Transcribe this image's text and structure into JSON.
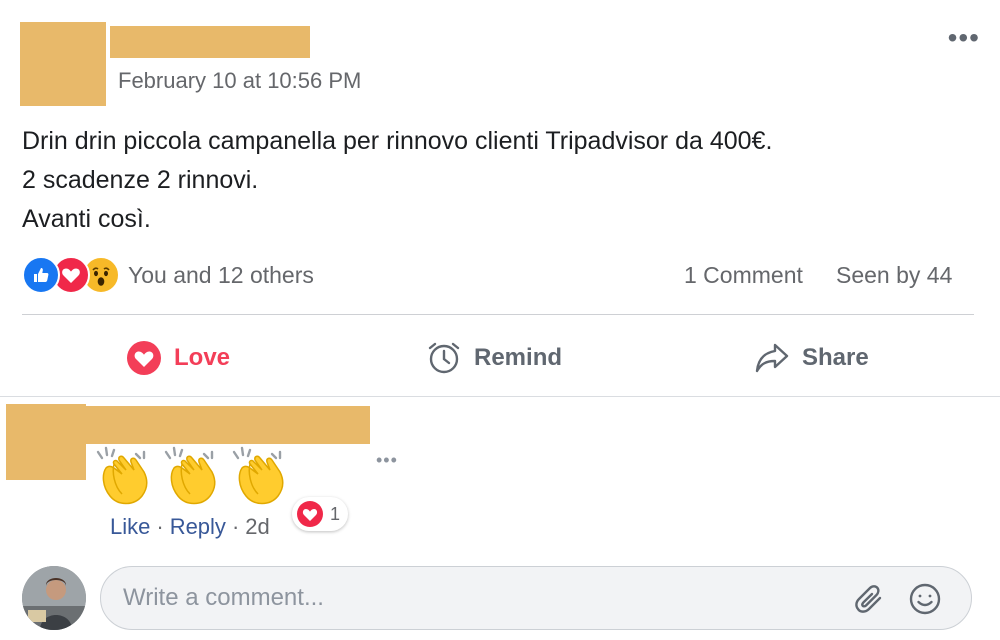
{
  "post": {
    "timestamp": "February 10 at 10:56 PM",
    "more_label": "•••",
    "body_lines": [
      "Drin drin piccola campanella per rinnovo clienti Tripadvisor da 400€.",
      "2 scadenze 2 rinnovi.",
      "Avanti così."
    ],
    "reactors_text": "You and 12 others",
    "reactions": [
      "like-icon",
      "love-icon",
      "wow-icon"
    ],
    "comment_count": "1 Comment",
    "seen_by": "Seen by 44"
  },
  "actions": {
    "love": "Love",
    "remind": "Remind",
    "share": "Share"
  },
  "comment": {
    "emoji": [
      "clapping-hands",
      "clapping-hands",
      "clapping-hands"
    ],
    "more_label": "•••",
    "like": "Like",
    "reply": "Reply",
    "separator": "·",
    "age": "2d",
    "reaction_count": "1"
  },
  "composer": {
    "placeholder": "Write a comment..."
  },
  "colors": {
    "redaction": "#e8b96a",
    "love": "#f33e58",
    "link": "#385898",
    "like_blue": "#1877f2"
  }
}
